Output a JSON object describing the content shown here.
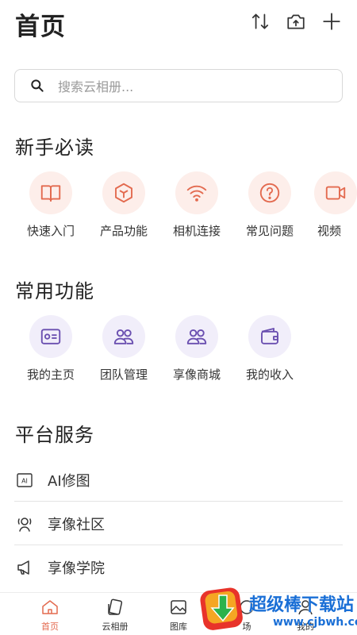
{
  "header": {
    "title": "首页",
    "icons": [
      "sort-icon",
      "camera-upload-icon",
      "add-icon"
    ]
  },
  "search": {
    "placeholder": "搜索云相册..."
  },
  "section_guide": {
    "title": "新手必读",
    "items": [
      {
        "label": "快速入门",
        "icon": "book-icon"
      },
      {
        "label": "产品功能",
        "icon": "cube-icon"
      },
      {
        "label": "相机连接",
        "icon": "wifi-icon"
      },
      {
        "label": "常见问题",
        "icon": "question-icon"
      },
      {
        "label": "视频",
        "icon": "video-icon"
      }
    ]
  },
  "section_common": {
    "title": "常用功能",
    "items": [
      {
        "label": "我的主页",
        "icon": "id-card-icon"
      },
      {
        "label": "团队管理",
        "icon": "team-icon"
      },
      {
        "label": "享像商城",
        "icon": "team-store-icon"
      },
      {
        "label": "我的收入",
        "icon": "wallet-icon"
      }
    ]
  },
  "section_platform": {
    "title": "平台服务",
    "items": [
      {
        "label": "AI修图",
        "icon": "ai-icon"
      },
      {
        "label": "享像社区",
        "icon": "community-icon"
      },
      {
        "label": "享像学院",
        "icon": "megaphone-icon"
      }
    ]
  },
  "tabbar": {
    "tabs": [
      {
        "label": "首页",
        "icon": "home-icon",
        "active": true
      },
      {
        "label": "云相册",
        "icon": "album-icon",
        "active": false
      },
      {
        "label": "图库",
        "icon": "gallery-icon",
        "active": false
      },
      {
        "label": "场",
        "icon": "square-icon",
        "active": false
      },
      {
        "label": "我的",
        "icon": "profile-icon",
        "active": false
      }
    ]
  },
  "watermark": {
    "name": "超级棒下载站",
    "url": "www.cjbwh.com"
  },
  "colors": {
    "accent": "#e36a4f",
    "peach_bg": "#fdeeea",
    "lavender_bg": "#f1eefa",
    "purple": "#6a4fb0",
    "watermark_blue": "#1a6fd6"
  }
}
